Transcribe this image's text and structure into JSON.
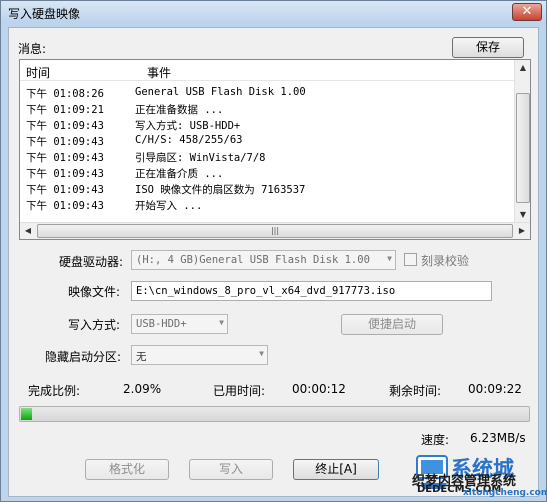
{
  "window": {
    "title": "写入硬盘映像",
    "close_label": "✕"
  },
  "messages": {
    "label": "消息:",
    "save_label": "保存",
    "columns": {
      "time": "时间",
      "event": "事件"
    },
    "rows": [
      {
        "time": "下午 01:08:26",
        "event": "General USB Flash Disk  1.00"
      },
      {
        "time": "下午 01:09:21",
        "event": "正在准备数据 ..."
      },
      {
        "time": "下午 01:09:43",
        "event": "写入方式: USB-HDD+"
      },
      {
        "time": "下午 01:09:43",
        "event": "C/H/S: 458/255/63"
      },
      {
        "time": "下午 01:09:43",
        "event": "引导扇区: WinVista/7/8"
      },
      {
        "time": "下午 01:09:43",
        "event": "正在准备介质 ..."
      },
      {
        "time": "下午 01:09:43",
        "event": "ISO 映像文件的扇区数为 7163537"
      },
      {
        "time": "下午 01:09:43",
        "event": "开始写入 ..."
      }
    ]
  },
  "form": {
    "drive_label": "硬盘驱动器:",
    "drive_value": "(H:, 4 GB)General USB Flash Disk  1.00",
    "verify_label": "刻录校验",
    "image_label": "映像文件:",
    "image_value": "E:\\cn_windows_8_pro_vl_x64_dvd_917773.iso",
    "mode_label": "写入方式:",
    "mode_value": "USB-HDD+",
    "quick_boot_label": "便捷启动",
    "hidden_label": "隐藏启动分区:",
    "hidden_value": "无"
  },
  "status": {
    "ratio_label": "完成比例:",
    "ratio_value": "2.09%",
    "elapsed_label": "已用时间:",
    "elapsed_value": "00:00:12",
    "remaining_label": "剩余时间:",
    "remaining_value": "00:09:22",
    "progress_fraction": 0.0209,
    "speed_label": "速度:",
    "speed_value": "6.23MB/s"
  },
  "buttons": {
    "format_label": "格式化",
    "write_label": "写入",
    "stop_label": "终止[A]"
  },
  "watermark": {
    "brand": "系统城",
    "line1": "织梦内容管理系统",
    "line2": "DEDECMS.COM",
    "line3": "xitongcheng.com"
  }
}
